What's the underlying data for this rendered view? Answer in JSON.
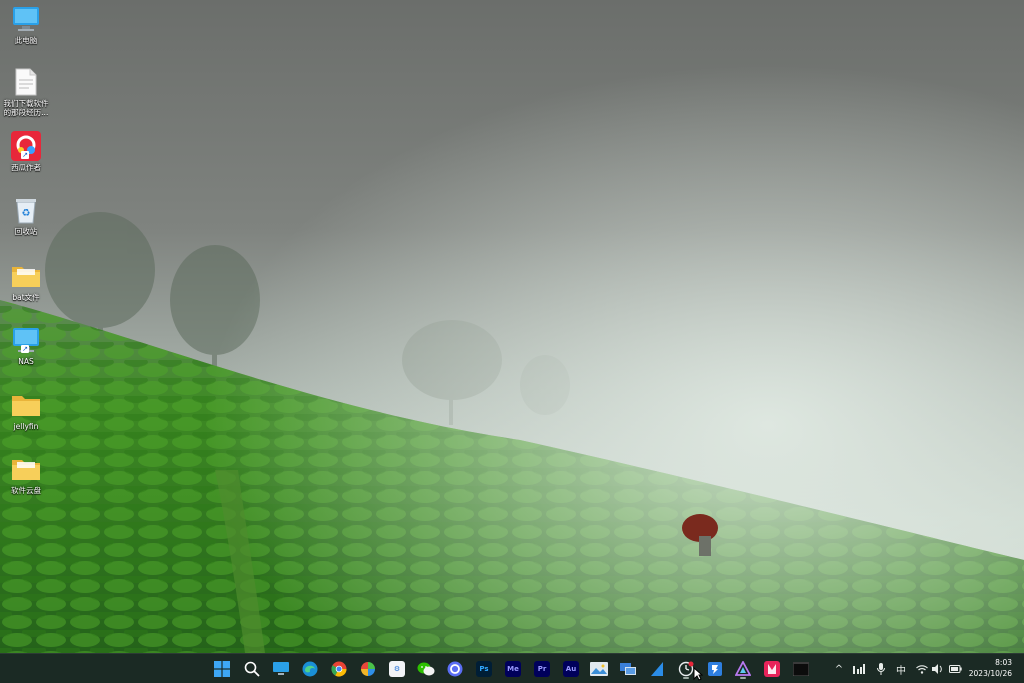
{
  "desktop": {
    "icons": [
      {
        "label": "此电脑",
        "icon": "monitor-icon"
      },
      {
        "label": "我们下载软件的那段经历...",
        "icon": "text-file-icon"
      },
      {
        "label": "西瓜作者",
        "icon": "app-red-icon"
      },
      {
        "label": "回收站",
        "icon": "recycle-bin-icon"
      },
      {
        "label": "bat文件",
        "icon": "folder-icon"
      },
      {
        "label": "NAS",
        "icon": "monitor-icon"
      },
      {
        "label": "jellyfin",
        "icon": "folder-icon"
      },
      {
        "label": "软件云盘",
        "icon": "folder-icon"
      }
    ]
  },
  "taskbar": {
    "apps": [
      {
        "name": "start",
        "icon": "windows-start-icon"
      },
      {
        "name": "search",
        "icon": "search-icon"
      },
      {
        "name": "desktop",
        "icon": "desktop-icon"
      },
      {
        "name": "edge",
        "icon": "edge-icon"
      },
      {
        "name": "chrome",
        "icon": "chrome-icon"
      },
      {
        "name": "colorful-app",
        "icon": "pinwheel-icon"
      },
      {
        "name": "game-controller",
        "icon": "gamepad-icon"
      },
      {
        "name": "wechat",
        "icon": "wechat-icon"
      },
      {
        "name": "circle-app",
        "icon": "circle-app-icon"
      },
      {
        "name": "photoshop",
        "label": "Ps",
        "icon": "photoshop-icon"
      },
      {
        "name": "media-encoder",
        "label": "Me",
        "icon": "media-encoder-icon"
      },
      {
        "name": "premiere",
        "label": "Pr",
        "icon": "premiere-icon"
      },
      {
        "name": "audition",
        "label": "Au",
        "icon": "audition-icon"
      },
      {
        "name": "photo-viewer",
        "icon": "image-icon"
      },
      {
        "name": "remote",
        "icon": "network-icon"
      },
      {
        "name": "sail-app",
        "icon": "sail-icon"
      },
      {
        "name": "clock-app",
        "icon": "clock-icon"
      },
      {
        "name": "pin-app",
        "icon": "pin-icon"
      },
      {
        "name": "prism-app",
        "icon": "prism-icon"
      },
      {
        "name": "red-app",
        "icon": "red-bookmark-icon"
      },
      {
        "name": "terminal",
        "icon": "terminal-icon"
      }
    ],
    "tray": {
      "chevron": "^",
      "ime": "中",
      "time": "8:03",
      "date": "2023/10/26"
    }
  },
  "colors": {
    "taskbar_bg": "#1b2a24",
    "accent_blue": "#1e90ff",
    "tea_green": "#3d8f1f"
  }
}
